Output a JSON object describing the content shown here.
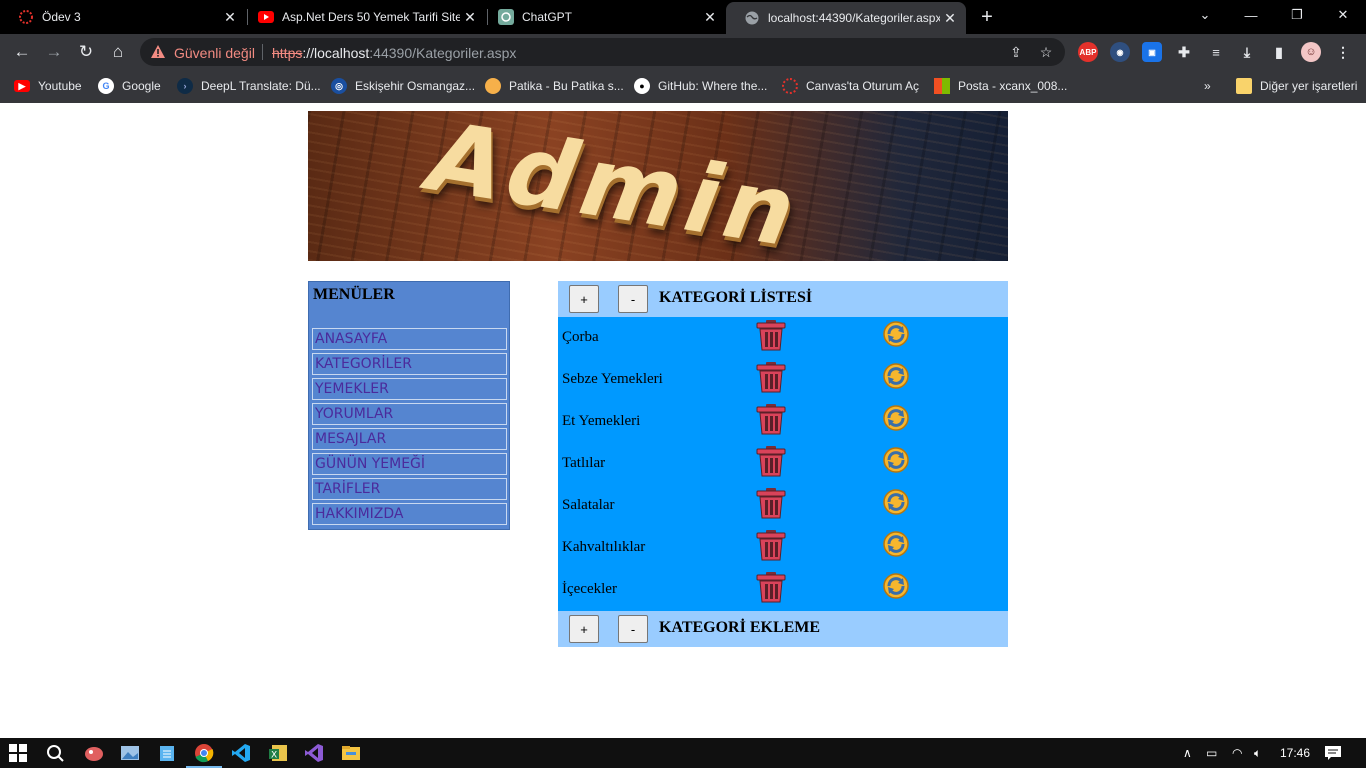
{
  "browser": {
    "tabs": [
      {
        "title": "Ödev 3",
        "icon": "canvas-ring-icon"
      },
      {
        "title": "Asp.Net Ders 50 Yemek Tarifi Site",
        "icon": "youtube-icon"
      },
      {
        "title": "ChatGPT",
        "icon": "chatgpt-icon"
      },
      {
        "title": "localhost:44390/Kategoriler.aspx",
        "icon": "globe-icon",
        "active": true
      }
    ],
    "security_label": "Güvenli değil",
    "url_scheme": "https",
    "url_host": "://localhost",
    "url_rest": ":44390/Kategoriler.aspx",
    "bookmarks": [
      {
        "label": "Youtube",
        "color": "#ff0000"
      },
      {
        "label": "Google",
        "color": "#ffffff"
      },
      {
        "label": "DeepL Translate: Dü...",
        "color": "#0f2b46"
      },
      {
        "label": "Eskişehir Osmangaz...",
        "color": "#1a4fa0"
      },
      {
        "label": "Patika - Bu Patika s...",
        "color": "#f6b04a"
      },
      {
        "label": "GitHub: Where the...",
        "color": "#ffffff"
      },
      {
        "label": "Canvas'ta Oturum Aç",
        "color": "#e4312b"
      },
      {
        "label": "Posta - xcanx_008...",
        "color": "#00a4ef"
      }
    ],
    "bookmarks_overflow": "»",
    "other_bookmarks": "Diğer yer işaretleri"
  },
  "banner": {
    "text": "Admin"
  },
  "menu": {
    "title": "MENÜLER",
    "items": [
      "ANASAYFA",
      "KATEGORİLER",
      "YEMEKLER",
      "YORUMLAR",
      "MESAJLAR",
      "GÜNÜN YEMEĞİ",
      "TARİFLER",
      "HAKKIMIZDA"
    ]
  },
  "category_list": {
    "plus_label": "+",
    "minus_label": "-",
    "title": "KATEGORİ LİSTESİ",
    "rows": [
      "Çorba",
      "Sebze Yemekleri",
      "Et Yemekleri",
      "Tatlılar",
      "Salatalar",
      "Kahvaltılıklar",
      "İçecekler"
    ]
  },
  "category_add": {
    "plus_label": "+",
    "minus_label": "-",
    "title": "KATEGORİ EKLEME"
  },
  "taskbar": {
    "clock": "17:46"
  },
  "colors": {
    "menu_bg": "#5585d0",
    "menu_link": "#4b2b9c",
    "panel_head": "#99ccff",
    "list_bg": "#0099ff"
  }
}
